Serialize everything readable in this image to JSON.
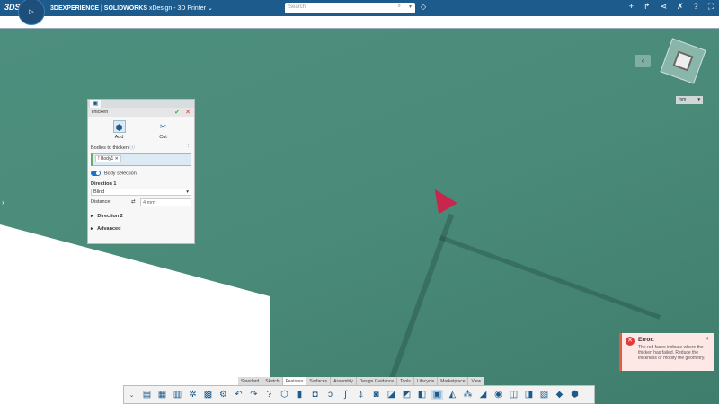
{
  "topbar": {
    "brand": "3DEXPERIENCE",
    "brand_sep": " | ",
    "product": "SOLIDWORKS",
    "app": " xDesign - 3D Printer",
    "compass_labels": [
      "3D",
      "V.R"
    ],
    "search_placeholder": "Search",
    "icons": [
      "plus-icon",
      "share-icon",
      "network-icon",
      "tools-icon",
      "help-icon",
      "fullscreen-icon"
    ]
  },
  "panel": {
    "title": "Thicken",
    "ops": [
      {
        "label": "Add",
        "active": true
      },
      {
        "label": "Cut",
        "active": false
      }
    ],
    "bodies_label": "Bodies to thicken",
    "body_chip": "Body1",
    "body_selection": "Body selection",
    "direction1": "Direction 1",
    "type": "Blind",
    "distance_label": "Distance",
    "distance_value": "4 mm",
    "direction2": "Direction 2",
    "advanced": "Advanced"
  },
  "error": {
    "title": "Error:",
    "message": "The red faces indicate where the thicken has failed. Reduce the thickness or modify the geometry."
  },
  "tabs": [
    "Standard",
    "Sketch",
    "Features",
    "Surfaces",
    "Assembly",
    "Design Guidance",
    "Tools",
    "Lifecycle",
    "Marketplace",
    "View"
  ],
  "active_tab": "Features",
  "units": "mm",
  "colors": {
    "topbar": "#1d5b8c",
    "viewport": "#4d8f7e",
    "error_accent": "#e25a44",
    "failed_face": "#c8264d"
  }
}
